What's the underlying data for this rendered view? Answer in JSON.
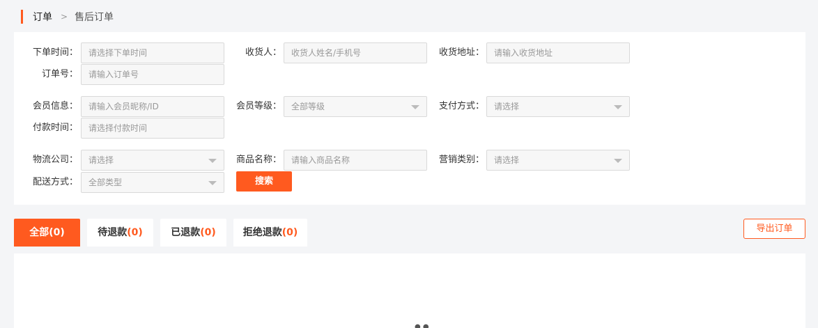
{
  "breadcrumb": {
    "level1": "订单",
    "separator": ">",
    "level2": "售后订单"
  },
  "filters": {
    "order_time": {
      "label": "下单时间：",
      "placeholder": "请选择下单时间"
    },
    "receiver": {
      "label": "收货人：",
      "placeholder": "收货人姓名/手机号"
    },
    "address": {
      "label": "收货地址：",
      "placeholder": "请输入收货地址"
    },
    "order_no": {
      "label": "订单号：",
      "placeholder": "请输入订单号"
    },
    "member_info": {
      "label": "会员信息：",
      "placeholder": "请输入会员昵称/ID"
    },
    "member_level": {
      "label": "会员等级：",
      "value": "全部等级"
    },
    "payment_method": {
      "label": "支付方式：",
      "value": "请选择"
    },
    "payment_time": {
      "label": "付款时间：",
      "placeholder": "请选择付款时间"
    },
    "logistics": {
      "label": "物流公司：",
      "value": "请选择"
    },
    "product_name": {
      "label": "商品名称：",
      "placeholder": "请输入商品名称"
    },
    "marketing_type": {
      "label": "营销类别：",
      "value": "请选择"
    },
    "delivery_method": {
      "label": "配送方式：",
      "value": "全部类型"
    },
    "search_label": "搜索"
  },
  "tabs": [
    {
      "label": "全部",
      "count": "(0)",
      "active": true
    },
    {
      "label": "待退款",
      "count": "(0)",
      "active": false
    },
    {
      "label": "已退款",
      "count": "(0)",
      "active": false
    },
    {
      "label": "拒绝退款",
      "count": "(0)",
      "active": false
    }
  ],
  "export_label": "导出订单",
  "colors": {
    "accent": "#ff5a1f"
  }
}
